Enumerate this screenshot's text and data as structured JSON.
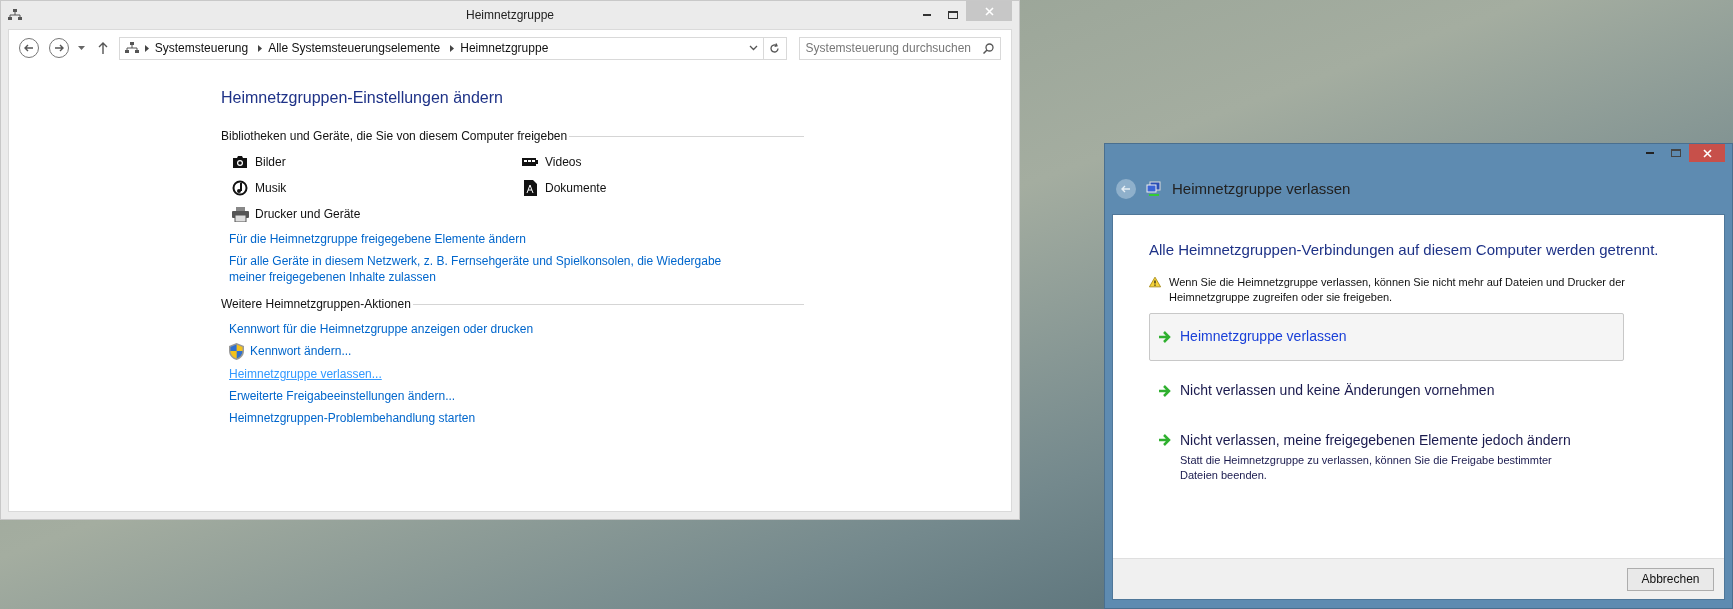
{
  "main_window": {
    "title": "Heimnetzgruppe",
    "address_bar": {
      "segments": [
        "Systemsteuerung",
        "Alle Systemsteuerungselemente",
        "Heimnetzgruppe"
      ]
    },
    "search": {
      "placeholder": "Systemsteuerung durchsuchen"
    },
    "heading": "Heimnetzgruppen-Einstellungen ändern",
    "sections": [
      {
        "title": "Bibliotheken und Geräte, die Sie von diesem Computer freigeben",
        "libraries": [
          "Bilder",
          "Videos",
          "Musik",
          "Dokumente",
          "Drucker und Geräte"
        ],
        "links": [
          {
            "label": "Für die Heimnetzgruppe freigegebene Elemente ändern",
            "kind": "plain",
            "hovered": false
          },
          {
            "label": "Für alle Geräte in diesem Netzwerk, z. B. Fernsehgeräte und Spielkonsolen, die Wiedergabe meiner freigegebenen Inhalte zulassen",
            "kind": "plain",
            "hovered": false
          }
        ]
      },
      {
        "title": "Weitere Heimnetzgruppen-Aktionen",
        "links": [
          {
            "label": "Kennwort für die Heimnetzgruppe anzeigen oder drucken",
            "kind": "plain",
            "hovered": false
          },
          {
            "label": "Kennwort ändern...",
            "kind": "admin",
            "hovered": false
          },
          {
            "label": "Heimnetzgruppe verlassen...",
            "kind": "plain",
            "hovered": true
          },
          {
            "label": "Erweiterte Freigabeeinstellungen ändern...",
            "kind": "plain",
            "hovered": false
          },
          {
            "label": "Heimnetzgruppen-Problembehandlung starten",
            "kind": "plain",
            "hovered": false
          }
        ]
      }
    ]
  },
  "dialog": {
    "title": "Heimnetzgruppe verlassen",
    "heading": "Alle Heimnetzgruppen-Verbindungen auf diesem Computer werden getrennt.",
    "warning": "Wenn Sie die Heimnetzgruppe verlassen, können Sie nicht mehr auf Dateien und Drucker der Heimnetzgruppe zugreifen oder sie freigeben.",
    "options": [
      {
        "label": "Heimnetzgruppe verlassen",
        "selected": true
      },
      {
        "label": "Nicht verlassen und keine Änderungen vornehmen",
        "selected": false
      },
      {
        "label": "Nicht verlassen, meine freigegebenen Elemente jedoch ändern",
        "description": "Statt die Heimnetzgruppe zu verlassen, können Sie die Freigabe bestimmter Dateien beenden.",
        "selected": false
      }
    ],
    "button": "Abbrechen"
  }
}
